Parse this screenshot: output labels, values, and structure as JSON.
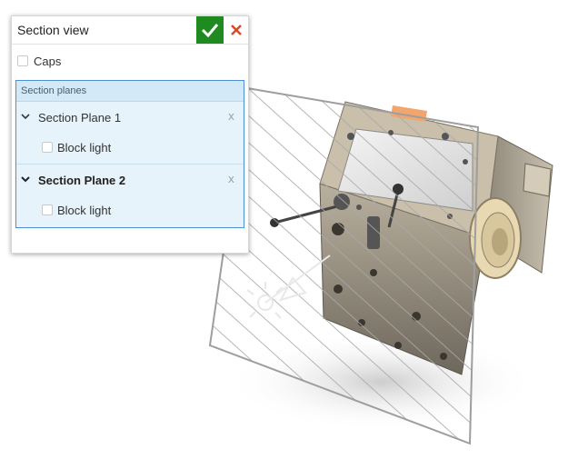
{
  "panel": {
    "title": "Section view",
    "accept_icon": "checkmark-icon",
    "close_icon": "close-icon",
    "accent_green": "#1f8a1f",
    "close_red": "#d94a2a",
    "caps": {
      "label": "Caps",
      "checked": false
    }
  },
  "section_planes": {
    "header": "Section planes",
    "planes": [
      {
        "name": "Section Plane 1",
        "remove_label": "x",
        "block_light": {
          "label": "Block light",
          "checked": false
        },
        "expanded": true,
        "bold": false
      },
      {
        "name": "Section Plane 2",
        "remove_label": "x",
        "block_light": {
          "label": "Block light",
          "checked": false
        },
        "expanded": true,
        "bold": true
      }
    ]
  },
  "viewport": {
    "model": "cad-assembly-cube",
    "plane_icon": "hatched-section-plane",
    "light_icon": "light-bulb-icon"
  }
}
